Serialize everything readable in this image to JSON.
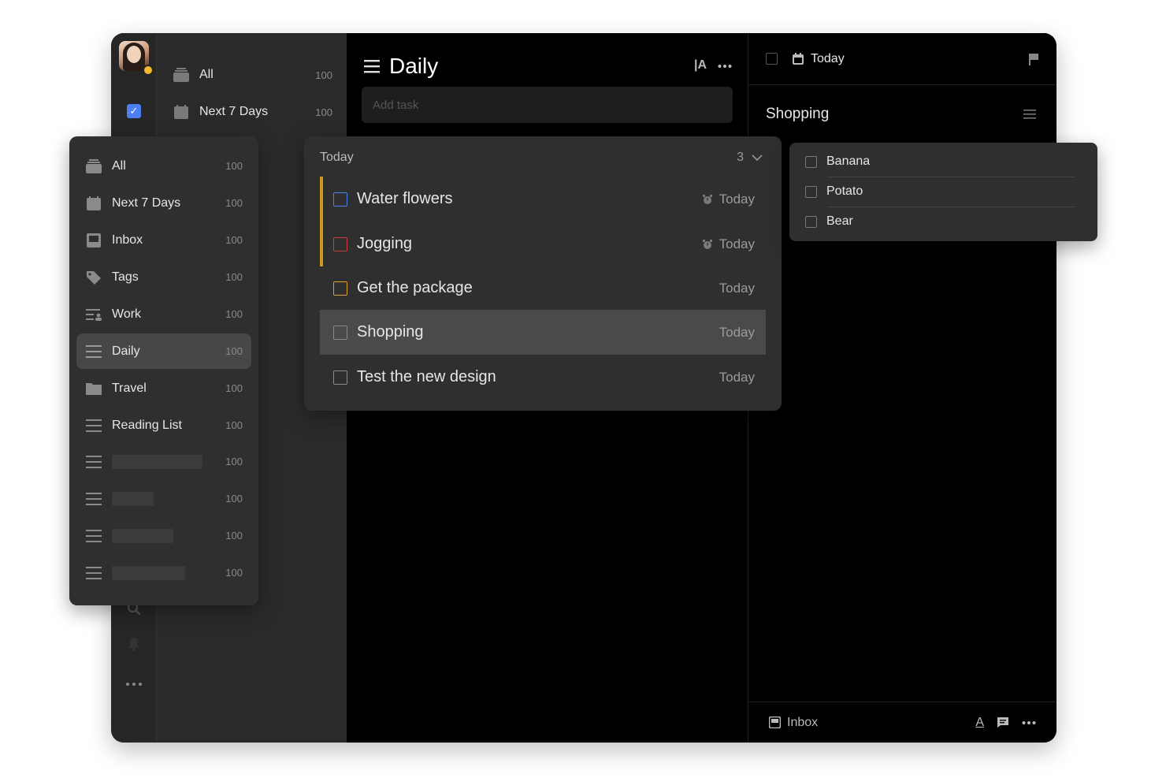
{
  "colors": {
    "accent": "#4e7ff2",
    "priority_high": "#d23b3b",
    "priority_med": "#e0a325",
    "priority_low": "#4e7ff2",
    "badge": "#f5b82e"
  },
  "rail": {
    "icons": [
      "avatar",
      "check-icon",
      "search-icon",
      "bell-icon",
      "more-icon"
    ]
  },
  "background_list": {
    "items": [
      {
        "label": "All",
        "count": "100",
        "icon": "inbox-stack-icon"
      },
      {
        "label": "Next 7 Days",
        "count": "100",
        "icon": "calendar-icon"
      }
    ]
  },
  "main": {
    "title": "Daily",
    "add_task_placeholder": "Add task"
  },
  "detail": {
    "date": "Today",
    "title": "Shopping",
    "footer_list": "Inbox"
  },
  "sidebar": {
    "items": [
      {
        "label": "All",
        "count": "100",
        "icon": "inbox-stack-icon"
      },
      {
        "label": "Next 7 Days",
        "count": "100",
        "icon": "calendar-icon"
      },
      {
        "label": "Inbox",
        "count": "100",
        "icon": "inbox-icon"
      },
      {
        "label": "Tags",
        "count": "100",
        "icon": "tag-icon"
      },
      {
        "label": "Work",
        "count": "100",
        "icon": "work-list-icon"
      },
      {
        "label": "Daily",
        "count": "100",
        "icon": "list-icon",
        "active": true
      },
      {
        "label": "Travel",
        "count": "100",
        "icon": "folder-icon"
      },
      {
        "label": "Reading List",
        "count": "100",
        "icon": "list-icon"
      },
      {
        "label": "",
        "count": "100",
        "icon": "list-icon"
      },
      {
        "label": "",
        "count": "100",
        "icon": "list-icon"
      },
      {
        "label": "",
        "count": "100",
        "icon": "list-icon"
      },
      {
        "label": "",
        "count": "100",
        "icon": "list-icon"
      }
    ]
  },
  "task_group": {
    "name": "Today",
    "count": "3",
    "tasks": [
      {
        "title": "Water flowers",
        "due": "Today",
        "priority": "low",
        "reminder": true
      },
      {
        "title": "Jogging",
        "due": "Today",
        "priority": "high",
        "reminder": true
      },
      {
        "title": "Get the package",
        "due": "Today",
        "priority": "med",
        "reminder": false
      },
      {
        "title": "Shopping",
        "due": "Today",
        "priority": "none",
        "reminder": false,
        "selected": true
      },
      {
        "title": "Test the new design",
        "due": "Today",
        "priority": "none",
        "reminder": false
      }
    ]
  },
  "checklist": {
    "items": [
      {
        "label": "Banana"
      },
      {
        "label": "Potato"
      },
      {
        "label": "Bear"
      }
    ]
  }
}
